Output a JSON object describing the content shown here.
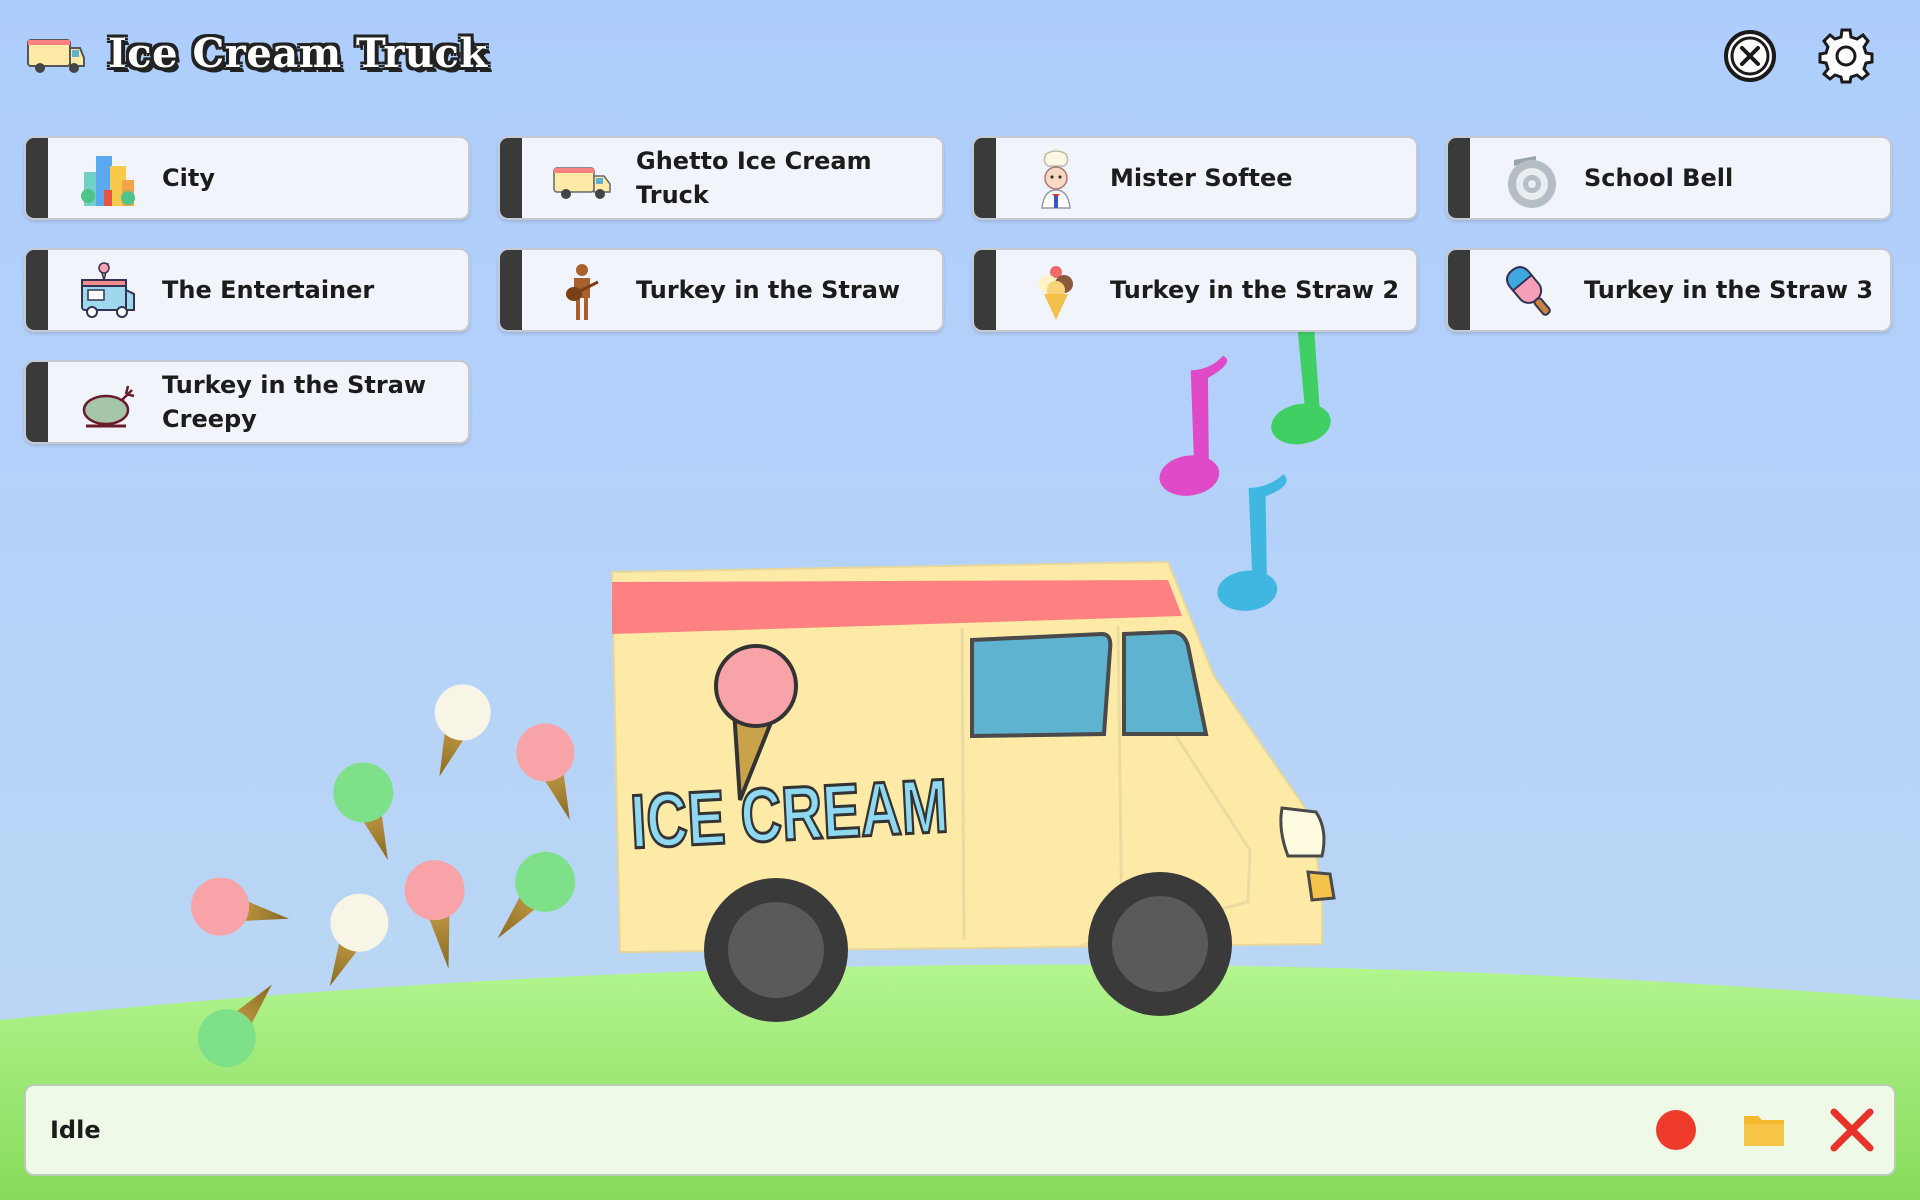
{
  "app": {
    "title": "Ice Cream Truck",
    "logo_icon": "ice-cream-truck-icon"
  },
  "header": {
    "close_icon": "circle-x-icon",
    "settings_icon": "gear-icon"
  },
  "sounds": [
    {
      "label": "City",
      "icon": "city-buildings-icon"
    },
    {
      "label": "Ghetto Ice Cream Truck",
      "icon": "ice-cream-truck-icon"
    },
    {
      "label": "Mister Softee",
      "icon": "mister-softee-icon"
    },
    {
      "label": "School Bell",
      "icon": "bell-icon"
    },
    {
      "label": "The Entertainer",
      "icon": "food-truck-icon"
    },
    {
      "label": "Turkey in the Straw",
      "icon": "guitarist-icon"
    },
    {
      "label": "Turkey in the Straw 2",
      "icon": "ice-cream-cone-icon"
    },
    {
      "label": "Turkey in the Straw 3",
      "icon": "popsicle-icon"
    },
    {
      "label": "Turkey in the Straw Creepy",
      "icon": "roast-turkey-icon"
    }
  ],
  "scene": {
    "truck_sign": "ICE CREAM",
    "truck_color": "#fdeaa6",
    "stripe_color": "#fd8181",
    "window_color": "#5eb3d1",
    "note_colors": [
      "#e04ac8",
      "#3fcf63",
      "#3fb7e0"
    ],
    "grass_color": "#9ce87a"
  },
  "status": {
    "text": "Idle",
    "record_icon": "record-icon",
    "folder_icon": "folder-icon",
    "stop_icon": "close-x-icon",
    "record_color": "#ef3b2c",
    "folder_color": "#f5b930",
    "stop_color": "#e8322a"
  }
}
